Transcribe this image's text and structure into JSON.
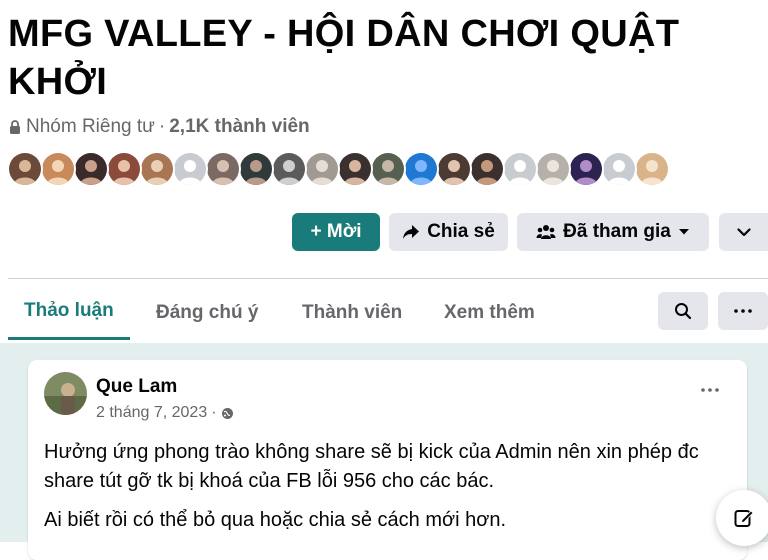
{
  "group": {
    "title": "MFG VALLEY - HỘI DÂN CHƠI QUẬT KHỞI",
    "privacy": "Nhóm Riêng tư",
    "separator": "·",
    "members": "2,1K thành viên"
  },
  "member_avatars": [
    {
      "color": "#6b4a3a",
      "accent": "#d9b89a"
    },
    {
      "color": "#c98a5b",
      "accent": "#f2d6b6"
    },
    {
      "color": "#3b2a2a",
      "accent": "#c9a08a"
    },
    {
      "color": "#8a4b3c",
      "accent": "#e8c2a8"
    },
    {
      "color": "#a87654",
      "accent": "#e9cfb3"
    },
    {
      "color": "#c8cbd0",
      "accent": "#ffffff"
    },
    {
      "color": "#7b6a63",
      "accent": "#d8c0b0"
    },
    {
      "color": "#2f3a3a",
      "accent": "#b99a86"
    },
    {
      "color": "#5b5b5b",
      "accent": "#cfcfcf"
    },
    {
      "color": "#a09a92",
      "accent": "#e6ddd3"
    },
    {
      "color": "#3a3030",
      "accent": "#d8b59d"
    },
    {
      "color": "#566050",
      "accent": "#c7b7a6"
    },
    {
      "color": "#1f78d1",
      "accent": "#7fb6ff"
    },
    {
      "color": "#4b3b33",
      "accent": "#e1c4ad"
    },
    {
      "color": "#3c2f2f",
      "accent": "#c49a7d"
    },
    {
      "color": "#c8cbd0",
      "accent": "#ffffff"
    },
    {
      "color": "#b5b0aa",
      "accent": "#ece5de"
    },
    {
      "color": "#2d2350",
      "accent": "#b08cc8"
    },
    {
      "color": "#c8cbd0",
      "accent": "#ffffff"
    },
    {
      "color": "#d9b48a",
      "accent": "#f5e3cc"
    }
  ],
  "actions": {
    "invite": "+ Mời",
    "share": "Chia sẻ",
    "joined": "Đã tham gia"
  },
  "tabs": [
    {
      "label": "Thảo luận",
      "active": true
    },
    {
      "label": "Đáng chú ý",
      "active": false
    },
    {
      "label": "Thành viên",
      "active": false
    },
    {
      "label": "Xem thêm",
      "active": false
    }
  ],
  "post": {
    "author": "Que Lam",
    "date": "2 tháng 7, 2023",
    "date_separator": "·",
    "paragraphs": [
      "Hưởng ứng phong trào không share sẽ bị kick của Admin nên xin phép đc share tút gỡ tk bị khoá của FB lỗi 956 cho các bác.",
      "Ai biết rồi có thể bỏ qua hoặc chia sẻ cách mới hơn."
    ]
  },
  "colors": {
    "accent": "#1a7c7a",
    "secondary_button": "#e4e6eb",
    "feed_background": "#e3eeee",
    "muted_text": "#65676b"
  },
  "icons": {
    "lock": "lock-icon",
    "share": "share-arrow-icon",
    "joined": "group-people-icon",
    "dropdown": "caret-down-icon",
    "more_chevron": "chevron-down-icon",
    "search": "search-icon",
    "tab_more": "more-horizontal-icon",
    "post_menu": "more-horizontal-icon",
    "audience": "globe-icon",
    "compose": "compose-icon"
  }
}
